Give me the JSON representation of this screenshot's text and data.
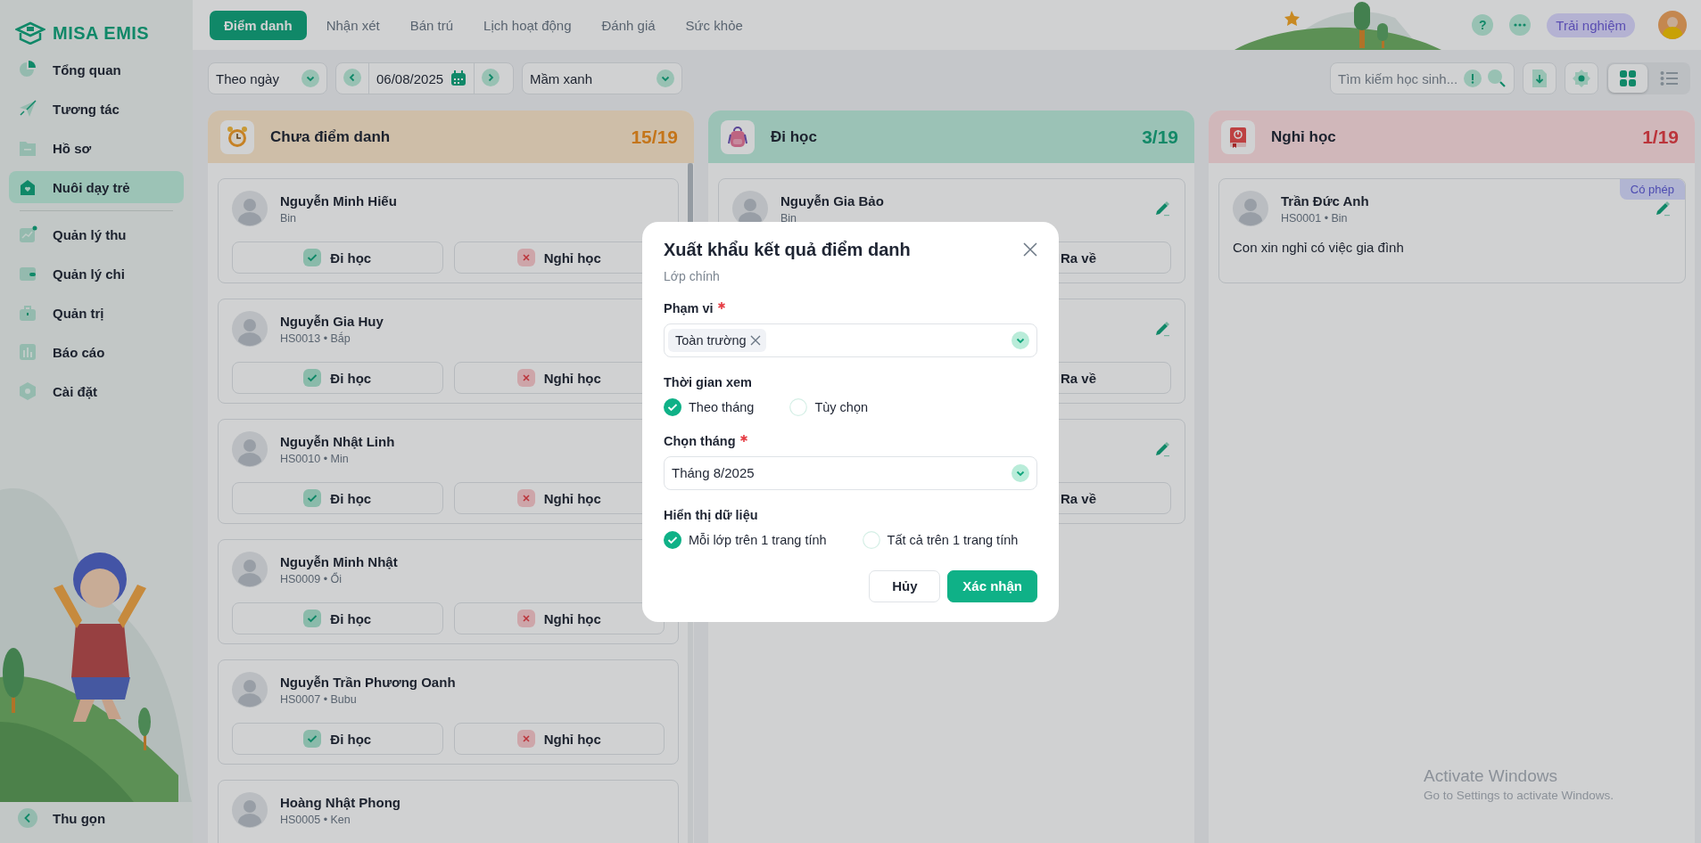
{
  "sidebar": {
    "logo": "MISA EMIS",
    "items": [
      {
        "label": "Tổng quan",
        "selected": false
      },
      {
        "label": "Tương tác",
        "selected": false
      },
      {
        "label": "Hồ sơ",
        "selected": false
      },
      {
        "label": "Nuôi dạy trẻ",
        "selected": true
      },
      {
        "label": "Quản lý thu",
        "selected": false
      },
      {
        "label": "Quản lý chi",
        "selected": false
      },
      {
        "label": "Quản trị",
        "selected": false
      },
      {
        "label": "Báo cáo",
        "selected": false
      },
      {
        "label": "Cài đặt",
        "selected": false
      }
    ],
    "collapse": "Thu gọn"
  },
  "tabs": [
    {
      "label": "Điểm danh",
      "selected": true
    },
    {
      "label": "Nhận xét",
      "selected": false
    },
    {
      "label": "Bán trú",
      "selected": false
    },
    {
      "label": "Lịch hoạt động",
      "selected": false
    },
    {
      "label": "Đánh giá",
      "selected": false
    },
    {
      "label": "Sức khỏe",
      "selected": false
    }
  ],
  "header": {
    "help": "?",
    "trial": "Trải nghiệm"
  },
  "toolbar": {
    "mode": "Theo ngày",
    "date": "06/08/2025",
    "class": "Mầm xanh",
    "search_placeholder": "Tìm kiếm học sinh...",
    "views": [
      {
        "kind": "grid",
        "selected": true
      },
      {
        "kind": "list",
        "selected": false
      }
    ]
  },
  "columns": [
    {
      "kind": "pending",
      "title": "Chưa điểm danh",
      "count": "15/19",
      "cards": [
        {
          "name": "Nguyễn Minh Hiếu",
          "sub": "Bin",
          "actions": [
            {
              "kind": "present",
              "label": "Đi học"
            },
            {
              "kind": "absent",
              "label": "Nghỉ học"
            }
          ]
        },
        {
          "name": "Nguyễn Gia Huy",
          "sub": "HS0013 • Bắp",
          "actions": [
            {
              "kind": "present",
              "label": "Đi học"
            },
            {
              "kind": "absent",
              "label": "Nghỉ học"
            }
          ]
        },
        {
          "name": "Nguyễn Nhật Linh",
          "sub": "HS0010 • Min",
          "actions": [
            {
              "kind": "present",
              "label": "Đi học"
            },
            {
              "kind": "absent",
              "label": "Nghỉ học"
            }
          ]
        },
        {
          "name": "Nguyễn Minh Nhật",
          "sub": "HS0009 • Ổi",
          "actions": [
            {
              "kind": "present",
              "label": "Đi học"
            },
            {
              "kind": "absent",
              "label": "Nghỉ học"
            }
          ]
        },
        {
          "name": "Nguyễn Trần Phương Oanh",
          "sub": "HS0007 • Bubu",
          "actions": [
            {
              "kind": "present",
              "label": "Đi học"
            },
            {
              "kind": "absent",
              "label": "Nghỉ học"
            }
          ]
        },
        {
          "name": "Hoàng Nhật Phong",
          "sub": "HS0005 • Ken"
        }
      ]
    },
    {
      "kind": "present",
      "title": "Đi học",
      "count": "3/19",
      "cards": [
        {
          "name": "Nguyễn Gia Bảo",
          "sub": "Bin",
          "editable": true,
          "actions": [
            {
              "kind": "leave",
              "label": "Ra về"
            }
          ]
        },
        {
          "editable": true,
          "actions": [
            {
              "kind": "leave",
              "label": "Ra về"
            }
          ]
        },
        {
          "editable": true,
          "actions": [
            {
              "kind": "leave",
              "label": "Ra về"
            }
          ]
        }
      ]
    },
    {
      "kind": "absent",
      "title": "Nghỉ học",
      "count": "1/19",
      "cards": [
        {
          "name": "Trần Đức Anh",
          "sub": "HS0001 • Bin",
          "badge": "Có phép",
          "editable": true,
          "note": "Con xin nghỉ có việc gia đình"
        }
      ]
    }
  ],
  "modal": {
    "title": "Xuất khẩu kết quả điểm danh",
    "subtitle": "Lớp chính",
    "fields": [
      {
        "kind": "tags",
        "label": "Phạm vi",
        "required": true,
        "tags": [
          "Toàn trường"
        ]
      },
      {
        "kind": "radio",
        "label": "Thời gian xem",
        "options": [
          {
            "label": "Theo tháng",
            "selected": true
          },
          {
            "label": "Tùy chọn",
            "selected": false
          }
        ]
      },
      {
        "kind": "select",
        "label": "Chọn tháng",
        "required": true,
        "value": "Tháng 8/2025"
      },
      {
        "kind": "radio",
        "label": "Hiển thị dữ liệu",
        "options": [
          {
            "label": "Mỗi lớp trên 1 trang tính",
            "selected": true
          },
          {
            "label": "Tất cả trên 1 trang tính",
            "selected": false
          }
        ]
      }
    ],
    "buttons": [
      {
        "kind": "secondary",
        "label": "Hủy"
      },
      {
        "kind": "primary",
        "label": "Xác nhận"
      }
    ]
  },
  "os_notice": {
    "title": "Activate Windows",
    "text": "Go to Settings to activate Windows."
  }
}
